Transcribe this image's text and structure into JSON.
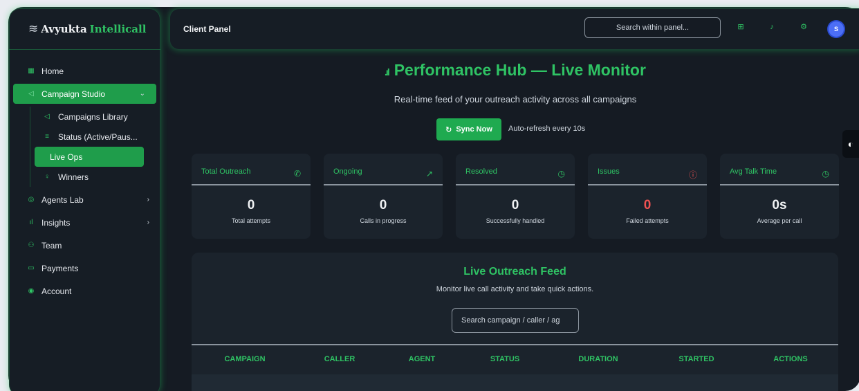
{
  "brand": {
    "name": "Avyukta",
    "accent": "Intellicall"
  },
  "sidebar": {
    "items": [
      {
        "label": "Home",
        "icon": "grid-icon"
      },
      {
        "label": "Campaign Studio",
        "icon": "megaphone-icon",
        "active": true
      },
      {
        "label": "Agents Lab",
        "icon": "robot-icon"
      },
      {
        "label": "Insights",
        "icon": "bar-chart-icon"
      },
      {
        "label": "Team",
        "icon": "users-icon"
      },
      {
        "label": "Payments",
        "icon": "card-icon"
      },
      {
        "label": "Account",
        "icon": "user-circle-icon"
      }
    ],
    "sub_items": [
      {
        "label": "Campaigns Library",
        "icon": "megaphone-icon"
      },
      {
        "label": "Status (Active/Paus...",
        "icon": "filter-icon"
      },
      {
        "label": "Live Ops",
        "icon": "pulse-icon",
        "active": true
      },
      {
        "label": "Winners",
        "icon": "trophy-icon"
      }
    ]
  },
  "header": {
    "title": "Client Panel",
    "search_placeholder": "Search within panel...",
    "avatar_initial": "S"
  },
  "main": {
    "title": "Performance Hub — Live Monitor",
    "subtitle": "Real-time feed of your outreach activity across all campaigns",
    "sync_label": "Sync Now",
    "auto_refresh": "Auto-refresh every 10s"
  },
  "cards": [
    {
      "title": "Total Outreach",
      "value": "0",
      "desc": "Total attempts",
      "icon": "phone-icon"
    },
    {
      "title": "Ongoing",
      "value": "0",
      "desc": "Calls in progress",
      "icon": "trend-up-icon"
    },
    {
      "title": "Resolved",
      "value": "0",
      "desc": "Successfully handled",
      "icon": "clock-icon"
    },
    {
      "title": "Issues",
      "value": "0",
      "desc": "Failed attempts",
      "icon": "alert-icon"
    },
    {
      "title": "Avg Talk Time",
      "value": "0s",
      "desc": "Average per call",
      "icon": "clock-icon"
    }
  ],
  "feed": {
    "title": "Live Outreach Feed",
    "subtitle": "Monitor live call activity and take quick actions.",
    "search_placeholder": "Search campaign / caller / ag",
    "columns": [
      "CAMPAIGN",
      "CALLER",
      "AGENT",
      "STATUS",
      "DURATION",
      "STARTED",
      "ACTIONS"
    ]
  },
  "colors": {
    "accent": "#2fc364",
    "danger": "#f05252",
    "background": "#151b23",
    "avatar": "#4c6ef5"
  }
}
